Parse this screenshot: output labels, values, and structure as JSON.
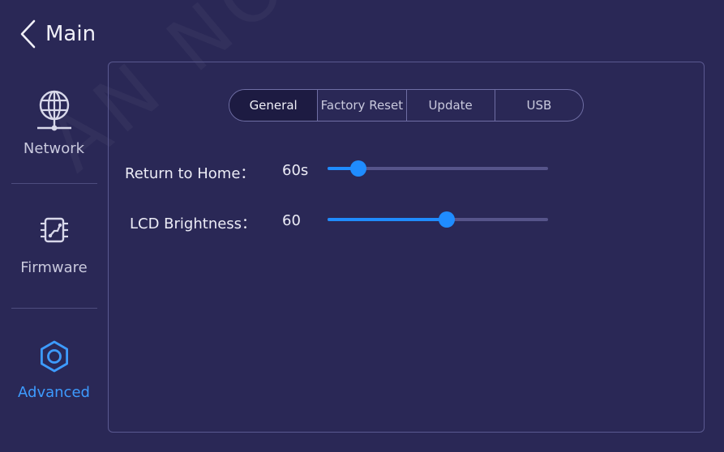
{
  "header": {
    "back_label": "Main"
  },
  "sidebar": {
    "items": [
      {
        "label": "Network",
        "icon": "network-globe-icon"
      },
      {
        "label": "Firmware",
        "icon": "chip-icon"
      },
      {
        "label": "Advanced",
        "icon": "gear-icon",
        "active": true
      }
    ]
  },
  "tabs": [
    {
      "label": "General",
      "active": true
    },
    {
      "label": "Factory Reset"
    },
    {
      "label": "Update"
    },
    {
      "label": "USB"
    }
  ],
  "settings": {
    "return_home": {
      "label": "Return to Home：",
      "value": "60s",
      "level": 0.14
    },
    "lcd_brightness": {
      "label": "LCD Brightness：",
      "value": "60",
      "level": 0.54
    }
  },
  "watermark": "AN NOVASTAR TE",
  "colors": {
    "background": "#2a2856",
    "accent": "#1f8cff",
    "track": "#56548a",
    "active_label": "#3d9bff"
  }
}
